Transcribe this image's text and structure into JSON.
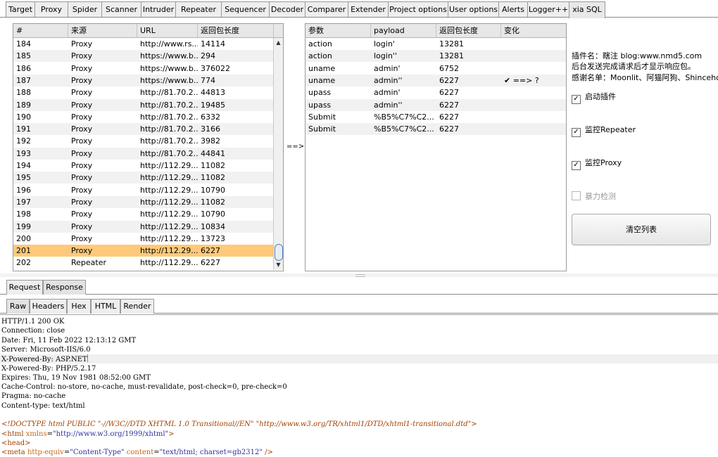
{
  "top_tabs": [
    "Target",
    "Proxy",
    "Spider",
    "Scanner",
    "Intruder",
    "Repeater",
    "Sequencer",
    "Decoder",
    "Comparer",
    "Extender",
    "Project options",
    "User options",
    "Alerts",
    "Logger++",
    "xia SQL"
  ],
  "active_top_tab": "xia SQL",
  "history": {
    "headers": [
      "#",
      "来源",
      "URL",
      "返回包长度"
    ],
    "rows": [
      [
        "184",
        "Proxy",
        "http://www.rs...",
        "14114"
      ],
      [
        "185",
        "Proxy",
        "https://www.b...",
        "294"
      ],
      [
        "186",
        "Proxy",
        "https://www.b...",
        "376022"
      ],
      [
        "187",
        "Proxy",
        "https://www.b...",
        "774"
      ],
      [
        "188",
        "Proxy",
        "http://81.70.2...",
        "44813"
      ],
      [
        "189",
        "Proxy",
        "http://81.70.2...",
        "19485"
      ],
      [
        "190",
        "Proxy",
        "http://81.70.2...",
        "6332"
      ],
      [
        "191",
        "Proxy",
        "http://81.70.2...",
        "3166"
      ],
      [
        "192",
        "Proxy",
        "http://81.70.2...",
        "3982"
      ],
      [
        "193",
        "Proxy",
        "http://81.70.2...",
        "44841"
      ],
      [
        "194",
        "Proxy",
        "http://112.29....",
        "11082"
      ],
      [
        "195",
        "Proxy",
        "http://112.29....",
        "11082"
      ],
      [
        "196",
        "Proxy",
        "http://112.29....",
        "10790"
      ],
      [
        "197",
        "Proxy",
        "http://112.29....",
        "11082"
      ],
      [
        "198",
        "Proxy",
        "http://112.29....",
        "10790"
      ],
      [
        "199",
        "Proxy",
        "http://112.29....",
        "10834"
      ],
      [
        "200",
        "Proxy",
        "http://112.29....",
        "13723"
      ],
      [
        "201",
        "Proxy",
        "http://112.29....",
        "6227"
      ],
      [
        "202",
        "Repeater",
        "http://112.29....",
        "6227"
      ]
    ],
    "selected_index": 17
  },
  "arrow_label": "==>",
  "params": {
    "headers": [
      "参数",
      "payload",
      "返回包长度",
      "变化"
    ],
    "rows": [
      [
        "action",
        "login'",
        "13281",
        ""
      ],
      [
        "action",
        "login''",
        "13281",
        ""
      ],
      [
        "uname",
        "admin'",
        "6752",
        ""
      ],
      [
        "uname",
        "admin''",
        "6227",
        "✔ ==> ?"
      ],
      [
        "upass",
        "admin'",
        "6227",
        ""
      ],
      [
        "upass",
        "admin''",
        "6227",
        ""
      ],
      [
        "Submit",
        "%B5%C7%C2...",
        "6227",
        ""
      ],
      [
        "Submit",
        "%B5%C7%C2...",
        "6227",
        ""
      ]
    ]
  },
  "plugin_info": {
    "line1": "插件名：瞎注 blog:www.nmd5.com",
    "line2": "后台发送完成请求后才显示响应包。",
    "line3": "感谢名单：Moonlit、阿猫阿狗、Shincehor"
  },
  "options": {
    "enable_plugin": {
      "label": "启动插件",
      "checked": true
    },
    "monitor_repeater": {
      "label": "监控Repeater",
      "checked": true
    },
    "monitor_proxy": {
      "label": "监控Proxy",
      "checked": true
    },
    "brute_detect": {
      "label": "暴力检测",
      "checked": false
    }
  },
  "clear_button": "清空列表",
  "req_resp_tabs": [
    "Request",
    "Response"
  ],
  "active_req_resp": "Response",
  "view_tabs": [
    "Raw",
    "Headers",
    "Hex",
    "HTML",
    "Render"
  ],
  "active_view": "Raw",
  "response_lines": [
    "HTTP/1.1 200 OK",
    "Connection: close",
    "Date: Fri, 11 Feb 2022 12:13:12 GMT",
    "Server: Microsoft-IIS/6.0",
    "X-Powered-By: ASP.NET",
    "X-Powered-By: PHP/5.2.17",
    "Expires: Thu, 19 Nov 1981 08:52:00 GMT",
    "Cache-Control: no-store, no-cache, must-revalidate, post-check=0, pre-check=0",
    "Pragma: no-cache",
    "Content-type: text/html",
    "",
    "<!DOCTYPE html PUBLIC \"-//W3C//DTD XHTML 1.0 Transitional//EN\" \"http://www.w3.org/TR/xhtml1/DTD/xhtml1-transitional.dtd\">",
    "<html xmlns=\"http://www.w3.org/1999/xhtml\">",
    "<head>",
    "<meta http-equiv=\"Content-Type\" content=\"text/html; charset=gb2312\" />"
  ],
  "highlight_line_index": 4,
  "colors": {
    "selected_row": "#ffc97a",
    "html_tag": "#a04000"
  }
}
